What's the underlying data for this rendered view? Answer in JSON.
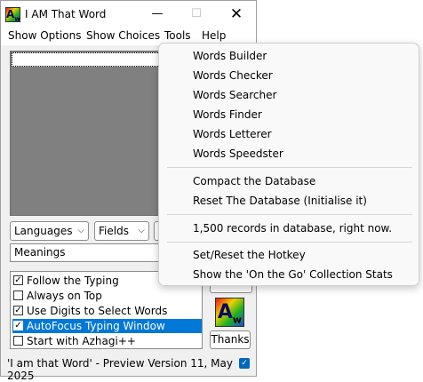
{
  "window": {
    "title": "I AM That Word",
    "icon_text": "A",
    "icon_sub": "w"
  },
  "titlebar": {
    "minimize": "—",
    "maximize": "☐",
    "close": "✕"
  },
  "menubar": {
    "items": [
      "Show Options",
      "Show Choices",
      "Tools",
      "Help"
    ]
  },
  "controls": {
    "languages": "Languages",
    "fields": "Fields",
    "chevron": "⌵",
    "meanings": "Meanings"
  },
  "options": [
    {
      "label": "Follow the Typing",
      "checked": true,
      "selected": false
    },
    {
      "label": "Always on Top",
      "checked": false,
      "selected": false
    },
    {
      "label": "Use Digits to Select Words",
      "checked": true,
      "selected": false
    },
    {
      "label": "AutoFocus Typing Window",
      "checked": true,
      "selected": true
    },
    {
      "label": "Start with Azhagi++",
      "checked": false,
      "selected": false
    }
  ],
  "side": {
    "thanks": "Thanks",
    "logo_text": "A",
    "logo_sub": "w"
  },
  "status": {
    "text": "'I am that Word' - Preview Version 11, May 2025",
    "check": "✓"
  },
  "tools_menu": {
    "group1": [
      "Words Builder",
      "Words Checker",
      "Words Searcher",
      "Words Finder",
      "Words Letterer",
      "Words Speedster"
    ],
    "group2": [
      "Compact the Database",
      "Reset The Database (Initialise it)"
    ],
    "group3": [
      "1,500 records in database, right now."
    ],
    "group4": [
      "Set/Reset the Hotkey",
      "Show the 'On the Go' Collection Stats"
    ]
  }
}
